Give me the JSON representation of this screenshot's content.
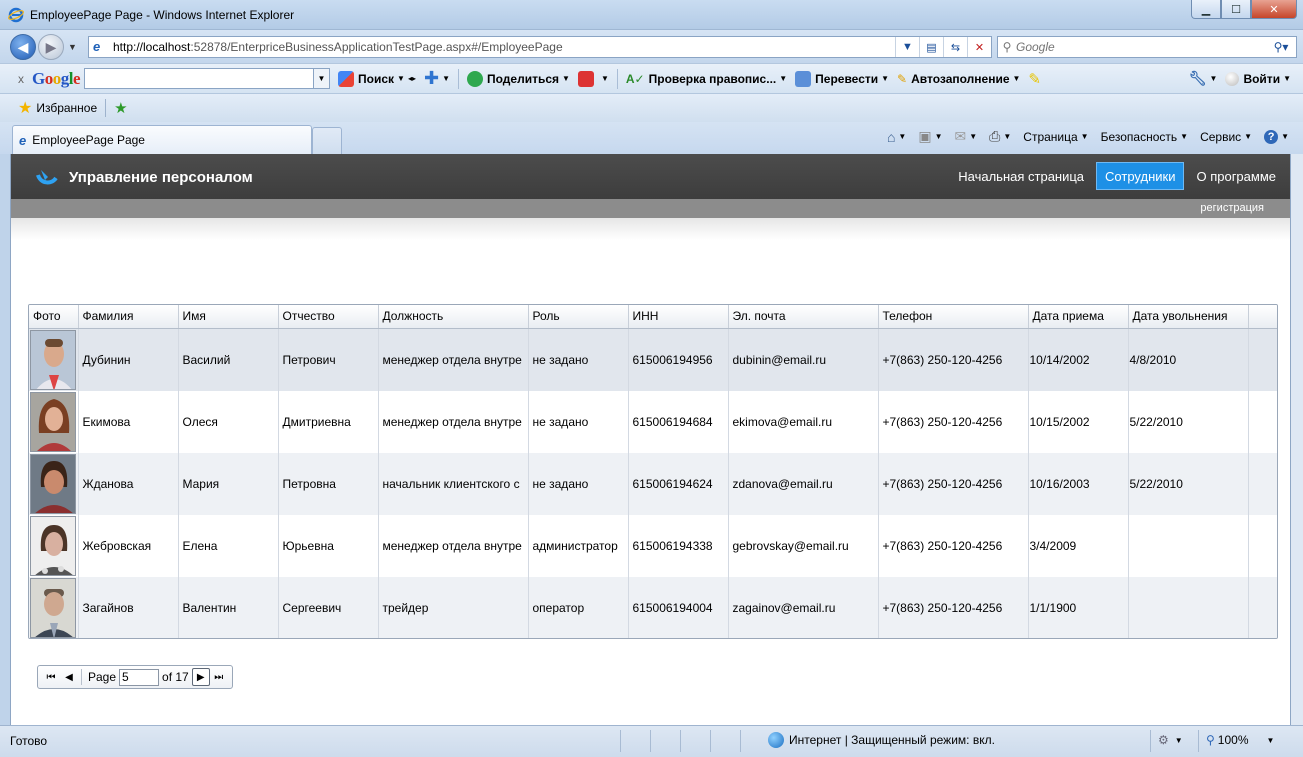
{
  "window": {
    "title": "EmployeePage Page - Windows Internet Explorer",
    "minimize": "▁",
    "maximize": "☐",
    "close": "✕"
  },
  "address": {
    "url_prefix": "http://localhost",
    "url_rest": ":52878/EnterpriceBusinessApplicationTestPage.aspx#/EmployeePage",
    "search_placeholder": "Google"
  },
  "google_toolbar": {
    "close": "x",
    "logo": [
      "G",
      "o",
      "o",
      "g",
      "l",
      "e"
    ],
    "search": "Поиск",
    "share": "Поделиться",
    "spellcheck": "Проверка правопис...",
    "translate": "Перевести",
    "autofill": "Автозаполнение",
    "signin": "Войти"
  },
  "favorites": {
    "label": "Избранное"
  },
  "tab": {
    "label": "EmployeePage Page"
  },
  "commands": {
    "page": "Страница",
    "security": "Безопасность",
    "tools": "Сервис"
  },
  "app": {
    "title": "Управление персоналом",
    "nav": [
      "Начальная страница",
      "Сотрудники",
      "О программе"
    ],
    "active_nav": "Сотрудники",
    "register": "регистрация"
  },
  "grid": {
    "columns": [
      "Фото",
      "Фамилия",
      "Имя",
      "Отчество",
      "Должность",
      "Роль",
      "ИНН",
      "Эл. почта",
      "Телефон",
      "Дата приема",
      "Дата увольнения"
    ],
    "rows": [
      {
        "last": "Дубинин",
        "first": "Василий",
        "middle": "Петрович",
        "position": "менеджер отдела внутре",
        "role": "не задано",
        "inn": "615006194956",
        "email": "dubinin@email.ru",
        "phone": "+7(863) 250-120-4256",
        "hired": "10/14/2002",
        "fired": "4/8/2010"
      },
      {
        "last": "Екимова",
        "first": "Олеся",
        "middle": "Дмитриевна",
        "position": "менеджер отдела внутре",
        "role": "не задано",
        "inn": "615006194684",
        "email": "ekimova@email.ru",
        "phone": "+7(863) 250-120-4256",
        "hired": "10/15/2002",
        "fired": "5/22/2010"
      },
      {
        "last": "Жданова",
        "first": "Мария",
        "middle": "Петровна",
        "position": "начальник клиентского с",
        "role": "не задано",
        "inn": "615006194624",
        "email": "zdanova@email.ru",
        "phone": "+7(863) 250-120-4256",
        "hired": "10/16/2003",
        "fired": "5/22/2010"
      },
      {
        "last": "Жебровская",
        "first": "Елена",
        "middle": "Юрьевна",
        "position": "менеджер отдела внутре",
        "role": "администратор",
        "inn": "615006194338",
        "email": "gebrovskay@email.ru",
        "phone": "+7(863) 250-120-4256",
        "hired": "3/4/2009",
        "fired": ""
      },
      {
        "last": "Загайнов",
        "first": "Валентин",
        "middle": "Сергеевич",
        "position": "трейдер",
        "role": "оператор",
        "inn": "615006194004",
        "email": "zagainov@email.ru",
        "phone": "+7(863) 250-120-4256",
        "hired": "1/1/1900",
        "fired": ""
      }
    ]
  },
  "pager": {
    "page_label": "Page",
    "page_value": "5",
    "of_label": "of 17"
  },
  "status": {
    "left": "Готово",
    "zone": "Интернет | Защищенный режим: вкл.",
    "zoom": "100%"
  },
  "colors": {
    "app_bar": "#444444",
    "active_nav": "#1e90e6",
    "sub_bar": "#8c8c8c"
  }
}
